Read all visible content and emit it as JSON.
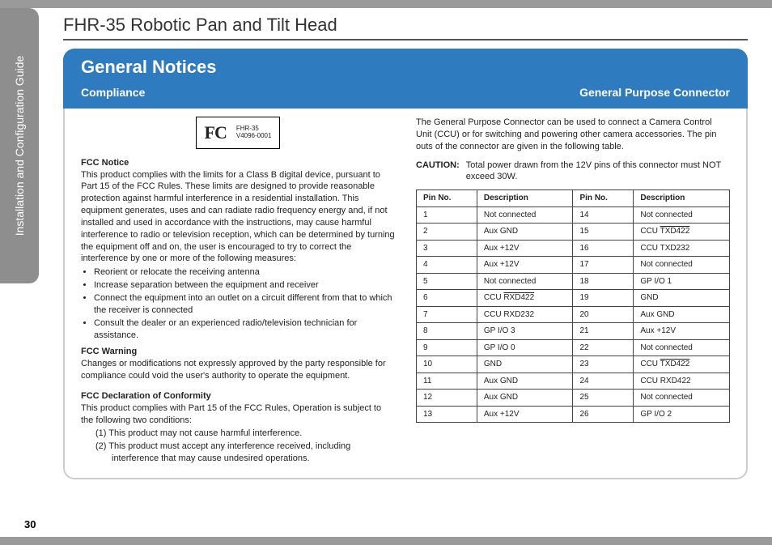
{
  "sidebar": {
    "label": "Installation and Configuration Guide"
  },
  "docTitle": "FHR-35 Robotic Pan and Tilt Head",
  "sectionTitle": "General Notices",
  "subheads": {
    "left": "Compliance",
    "right": "General Purpose Connector"
  },
  "fcc": {
    "logo": "FC",
    "model": "FHR-35",
    "code": "V4096-0001"
  },
  "leftCol": {
    "noticeHead": "FCC Notice",
    "noticeBody": "This product complies with the limits for a Class B digital device, pursuant to Part 15 of the FCC Rules.  These limits are designed to provide reasonable protection against harmful interference in a residential installation. This equipment generates, uses and can radiate radio frequency energy and, if not installed and used in accordance with the instructions, may cause harmful interference to radio or television reception, which can be determined by turning the equipment off and on, the user is encouraged to try to correct the interference by one or more of the following measures:",
    "bullets": [
      "Reorient or relocate the receiving antenna",
      "Increase separation between the equipment and receiver",
      "Connect the equipment into an outlet on a circuit different from that to which the receiver is connected",
      "Consult the dealer or an experienced radio/television technician for assistance."
    ],
    "warnHead": "FCC Warning",
    "warnBody": "Changes or modifications not expressly approved by the party responsible for compliance could void the user's authority to operate the equipment.",
    "declHead": "FCC Declaration of Conformity",
    "declIntro": "This product complies with Part 15 of the FCC Rules, Operation is subject to the following two conditions:",
    "declItems": [
      "This product may not cause harmful interference.",
      "This product must accept any interference received, including interference that may cause undesired operations."
    ]
  },
  "rightCol": {
    "intro": "The General Purpose Connector can be used to connect a Camera Control Unit (CCU) or for switching and powering other camera accessories. The pin outs of the connector are given in the following table.",
    "cautionLabel": "CAUTION:",
    "cautionBody": "Total power drawn from the 12V pins of this connector must NOT exceed 30W.",
    "headers": {
      "pin": "Pin No.",
      "desc": "Description"
    },
    "rows": [
      {
        "a": "1",
        "ad": "Not connected",
        "b": "14",
        "bd": "Not connected"
      },
      {
        "a": "2",
        "ad": "Aux GND",
        "b": "15",
        "bd": "CCU TXD422",
        "bd_ov": true
      },
      {
        "a": "3",
        "ad": "Aux +12V",
        "b": "16",
        "bd": "CCU TXD232"
      },
      {
        "a": "4",
        "ad": "Aux +12V",
        "b": "17",
        "bd": "Not connected"
      },
      {
        "a": "5",
        "ad": "Not connected",
        "b": "18",
        "bd": "GP I/O 1"
      },
      {
        "a": "6",
        "ad": "CCU RXD422",
        "ad_ov": true,
        "b": "19",
        "bd": "GND"
      },
      {
        "a": "7",
        "ad": "CCU RXD232",
        "b": "20",
        "bd": "Aux GND"
      },
      {
        "a": "8",
        "ad": "GP I/O 3",
        "b": "21",
        "bd": "Aux +12V"
      },
      {
        "a": "9",
        "ad": "GP I/O 0",
        "b": "22",
        "bd": "Not connected"
      },
      {
        "a": "10",
        "ad": "GND",
        "b": "23",
        "bd": "CCU TXD422",
        "bd_ov": true
      },
      {
        "a": "11",
        "ad": "Aux GND",
        "b": "24",
        "bd": "CCU RXD422"
      },
      {
        "a": "12",
        "ad": "Aux GND",
        "b": "25",
        "bd": "Not connected"
      },
      {
        "a": "13",
        "ad": "Aux +12V",
        "b": "26",
        "bd": "GP I/O 2"
      }
    ]
  },
  "pageNumber": "30"
}
